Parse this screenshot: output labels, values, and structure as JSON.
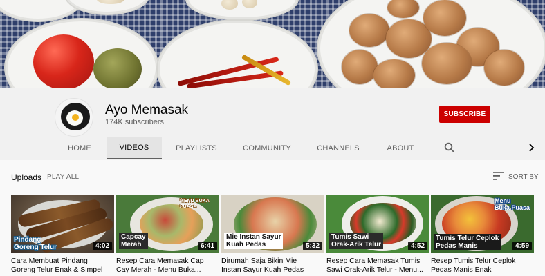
{
  "channel": {
    "name": "Ayo Memasak",
    "subscribers": "174K subscribers",
    "subscribe_label": "SUBSCRIBE"
  },
  "tabs": [
    {
      "label": "HOME",
      "active": false
    },
    {
      "label": "VIDEOS",
      "active": true
    },
    {
      "label": "PLAYLISTS",
      "active": false
    },
    {
      "label": "COMMUNITY",
      "active": false
    },
    {
      "label": "CHANNELS",
      "active": false
    },
    {
      "label": "ABOUT",
      "active": false
    }
  ],
  "icons": {
    "search": "search-icon",
    "next": "chevron-right-icon",
    "sort": "sort-icon"
  },
  "uploads": {
    "title": "Uploads",
    "play_all": "PLAY ALL",
    "sort_by": "SORT BY"
  },
  "videos": [
    {
      "title_line1": "Cara Membuat Pindang",
      "title_line2": "Goreng Telur Enak & Simpel",
      "duration": "4:02",
      "thumb_text": "Pindang\nGoreng Telur"
    },
    {
      "title_line1": "Resep Cara Memasak Cap",
      "title_line2": "Cay Merah - Menu Buka...",
      "duration": "6:41",
      "thumb_text": "Capcay\nMerah",
      "thumb_text2": "MENU BUKA\nPUASA"
    },
    {
      "title_line1": "Dirumah Saja Bikin Mie",
      "title_line2": "Instan Sayur Kuah Pedas",
      "duration": "5:32",
      "thumb_text": "Mie Instan Sayur\nKuah Pedas"
    },
    {
      "title_line1": "Resep Cara Memasak Tumis",
      "title_line2": "Sawi Orak-Arik Telur - Menu...",
      "duration": "4:52",
      "thumb_text": "Tumis Sawi\nOrak-Arik Telur"
    },
    {
      "title_line1": "Resep Tumis Telur Ceplok",
      "title_line2": "Pedas Manis Enak",
      "duration": "4:59",
      "thumb_text": "Tumis Telur Ceplok\nPedas Manis",
      "thumb_text2": "Menu\nBuka Puasa"
    }
  ],
  "colors": {
    "subscribe": "#cc0000",
    "header_bg": "#f1f1f1",
    "page_bg": "#f9f9f9"
  }
}
